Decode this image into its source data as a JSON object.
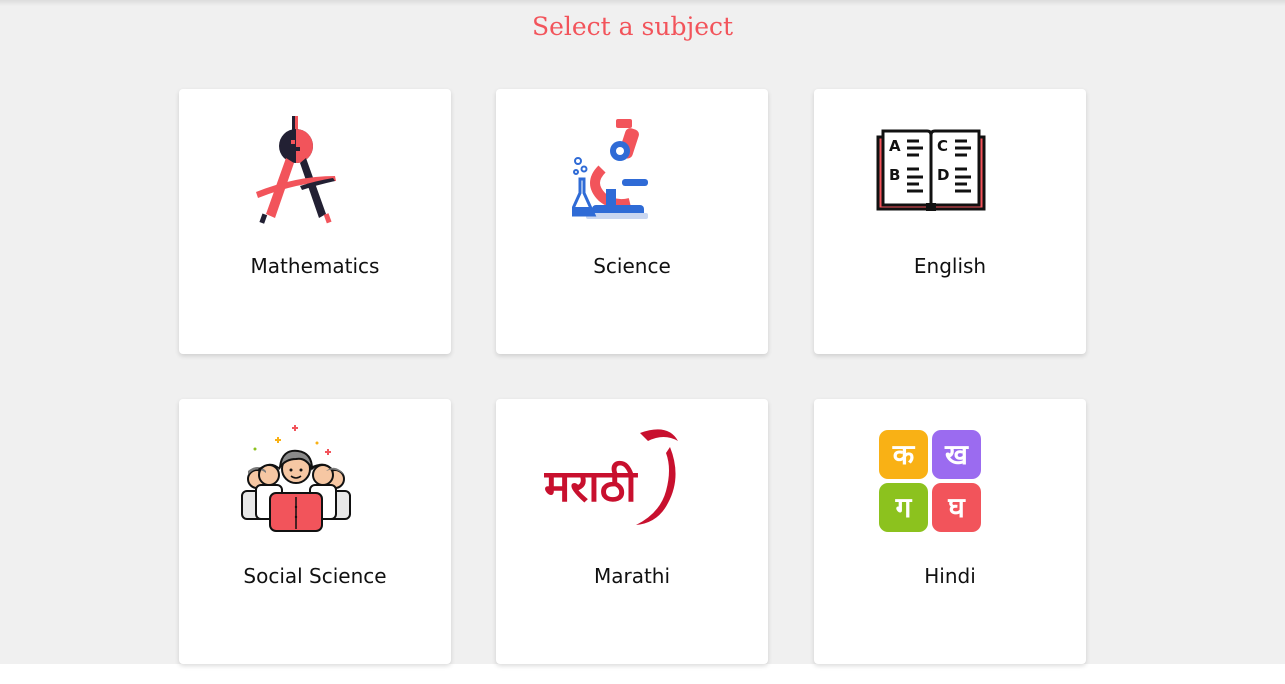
{
  "header": {
    "title": "Select a subject"
  },
  "subjects": [
    {
      "label": "Mathematics",
      "icon": "compass-icon"
    },
    {
      "label": "Science",
      "icon": "microscope-icon"
    },
    {
      "label": "English",
      "icon": "open-book-icon"
    },
    {
      "label": "Social Science",
      "icon": "people-group-icon"
    },
    {
      "label": "Marathi",
      "icon": "marathi-logo",
      "logo_text": "मराठी"
    },
    {
      "label": "Hindi",
      "icon": "hindi-letters-icon",
      "letters": [
        "क",
        "ख",
        "ग",
        "घ"
      ]
    }
  ],
  "colors": {
    "accent": "#f2545b",
    "background": "#f0f0f0",
    "card": "#ffffff",
    "dark": "#222033",
    "hindi_tiles": [
      "#f9b115",
      "#9b6bf0",
      "#8cc21e",
      "#f2545b"
    ],
    "marathi": "#c8102e"
  }
}
